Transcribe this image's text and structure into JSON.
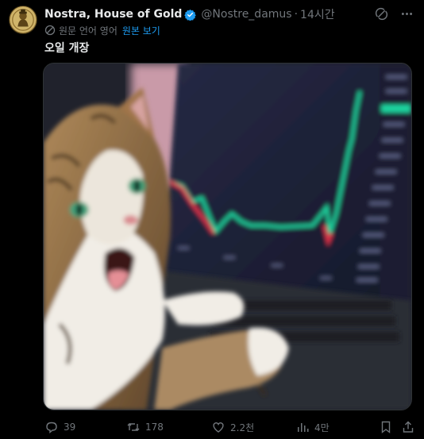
{
  "author": {
    "name": "Nostra, House of Gold",
    "handle": "@Nostre_damus",
    "time": "14시간",
    "verified_color": "#1d9bf0"
  },
  "translation": {
    "notice": "원문 언어 영어",
    "show_original": "원본 보기"
  },
  "tweet": {
    "text": "오일 개장"
  },
  "media": {
    "description_icon": "cat-photo",
    "accent_up": "#1fd6a0",
    "accent_down": "#e8364b"
  },
  "actions": {
    "replies": "39",
    "retweets": "178",
    "likes": "2.2천",
    "views": "4만"
  },
  "colors": {
    "background": "#000000",
    "text": "#e7e9ea",
    "muted": "#71767b",
    "link": "#1d9bf0"
  }
}
